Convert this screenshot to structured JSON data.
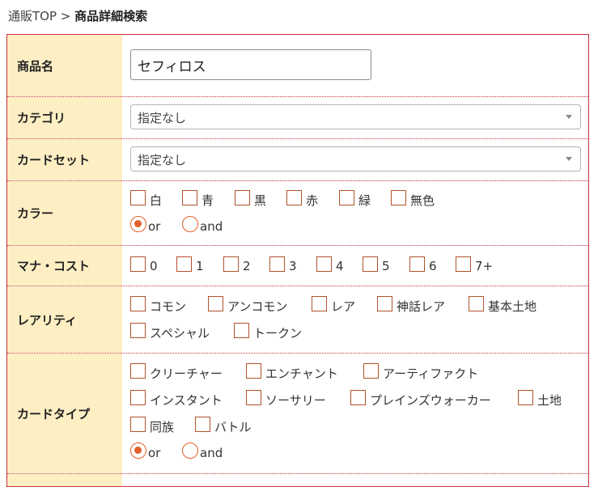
{
  "breadcrumb": {
    "home": "通販TOP",
    "sep": ">",
    "current": "商品詳細検索"
  },
  "rows": {
    "name": {
      "label": "商品名",
      "value": "セフィロス"
    },
    "category": {
      "label": "カテゴリ",
      "selected": "指定なし"
    },
    "cardset": {
      "label": "カードセット",
      "selected": "指定なし"
    },
    "color": {
      "label": "カラー",
      "options": [
        "白",
        "青",
        "黒",
        "赤",
        "緑",
        "無色"
      ],
      "mode": [
        "or",
        "and"
      ],
      "selected_mode": "or"
    },
    "mana": {
      "label": "マナ・コスト",
      "options": [
        "0",
        "1",
        "2",
        "3",
        "4",
        "5",
        "6",
        "7+"
      ]
    },
    "rarity": {
      "label": "レアリティ",
      "options": [
        "コモン",
        "アンコモン",
        "レア",
        "神話レア",
        "基本土地",
        "スペシャル",
        "トークン"
      ]
    },
    "cardtype": {
      "label": "カードタイプ",
      "options": [
        "クリーチャー",
        "エンチャント",
        "アーティファクト",
        "インスタント",
        "ソーサリー",
        "プレインズウォーカー",
        "土地",
        "同族",
        "バトル"
      ],
      "mode": [
        "or",
        "and"
      ],
      "selected_mode": "or"
    }
  }
}
